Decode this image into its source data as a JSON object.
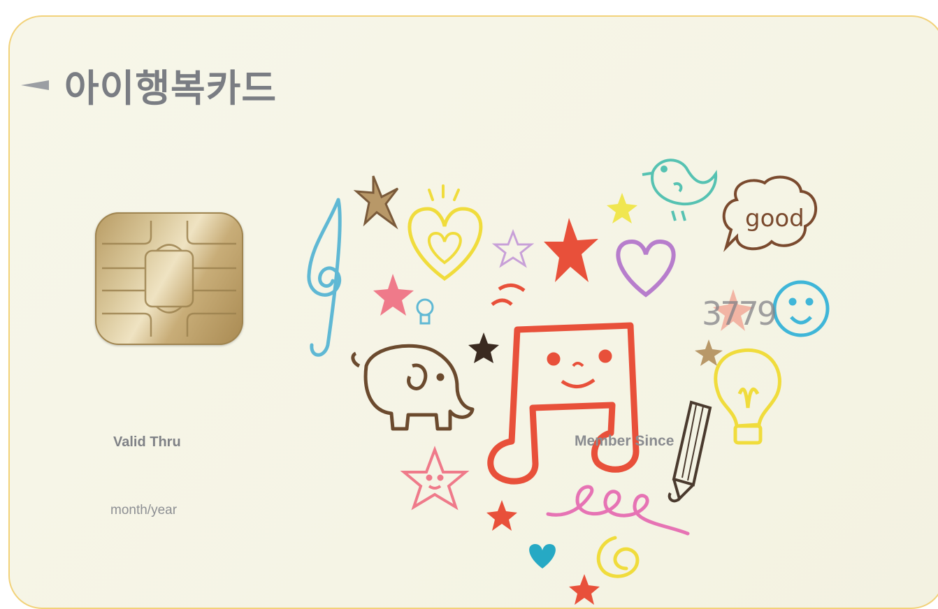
{
  "card": {
    "brand_name": "아이행복카드",
    "valid_thru_label": "Valid Thru",
    "expiry_placeholder": "month/year",
    "member_since_label": "Member Since",
    "card_number_fragment": "3779",
    "speech_bubble_text": "good"
  },
  "colors": {
    "card_background": "#f6f5e6",
    "card_border": "#f2d27a",
    "brand_text": "#7a7d83",
    "music_note": "#e8503a",
    "treble_clef": "#5fb8d4",
    "heart_purple": "#b77dcc",
    "heart_yellow": "#f0dc3c",
    "bird": "#56c2b2",
    "elephant": "#6b4a2e",
    "swirl_pink": "#e673b4"
  },
  "icons": {
    "brand_arrow": "left-triangle-icon",
    "chip": "emv-chip-icon"
  }
}
